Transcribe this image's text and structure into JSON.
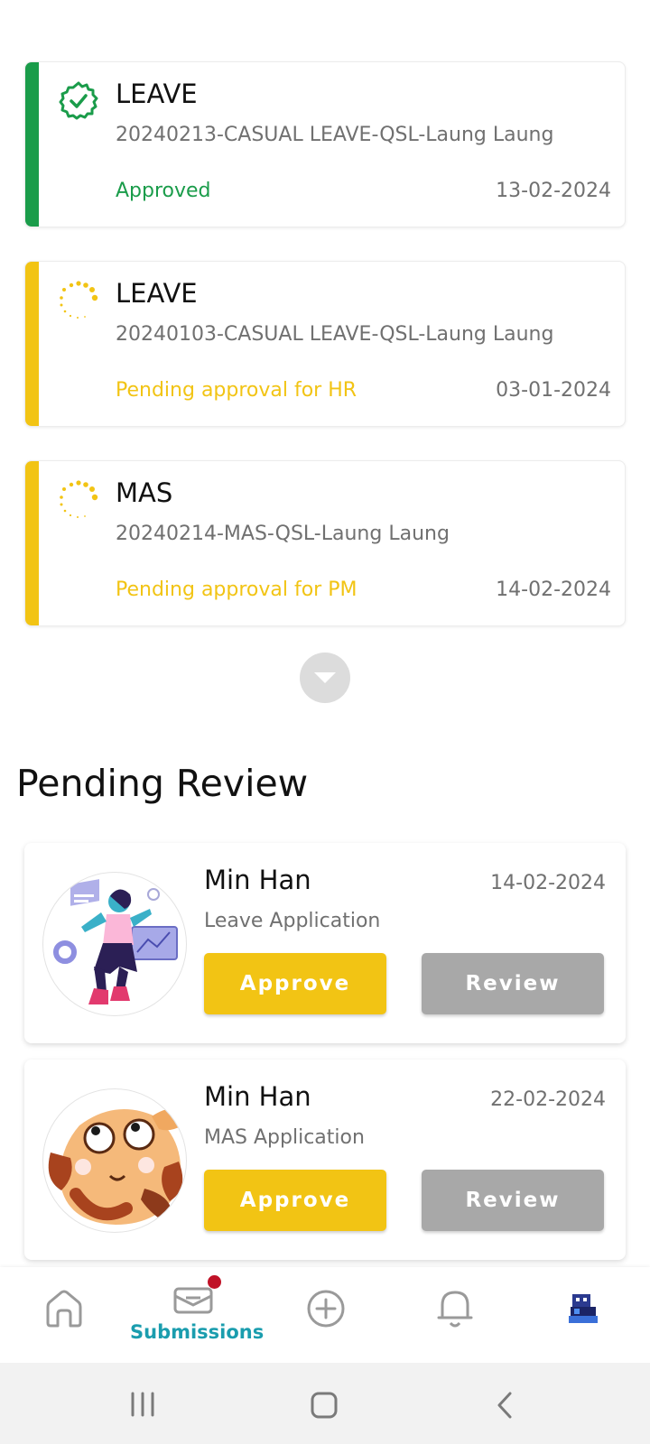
{
  "submissions": [
    {
      "type": "LEAVE",
      "ref": "20240213-CASUAL LEAVE-QSL-Laung Laung",
      "status": "Approved",
      "date": "13-02-2024",
      "state": "approved",
      "color": "#1a9c4a"
    },
    {
      "type": "LEAVE",
      "ref": "20240103-CASUAL LEAVE-QSL-Laung Laung",
      "status": "Pending approval for HR",
      "date": "03-01-2024",
      "state": "pending",
      "color": "#f2c414"
    },
    {
      "type": "MAS",
      "ref": "20240214-MAS-QSL-Laung Laung",
      "status": "Pending approval for PM",
      "date": "14-02-2024",
      "state": "pending",
      "color": "#f2c414"
    }
  ],
  "expand_icon": "chevron-down-icon",
  "pending_review": {
    "title": "Pending Review",
    "items": [
      {
        "name": "Min Han",
        "date": "14-02-2024",
        "type": "Leave Application",
        "approve_label": "Approve",
        "review_label": "Review",
        "avatar": "illustration-avatar"
      },
      {
        "name": "Min Han",
        "date": "22-02-2024",
        "type": "MAS Application",
        "approve_label": "Approve",
        "review_label": "Review",
        "avatar": "cartoon-avatar"
      }
    ]
  },
  "bottom_nav": {
    "items": [
      {
        "icon": "home-icon",
        "label": ""
      },
      {
        "icon": "mail-icon",
        "label": "Submissions",
        "active": true,
        "badge": true
      },
      {
        "icon": "add-circle-icon",
        "label": ""
      },
      {
        "icon": "bell-icon",
        "label": ""
      },
      {
        "icon": "profile-avatar-icon",
        "label": ""
      }
    ]
  },
  "system_nav": [
    "recents-icon",
    "home-button-icon",
    "back-icon"
  ],
  "colors": {
    "approved": "#1a9c4a",
    "pending": "#f2c414",
    "accent": "#1a9dae",
    "approve_button": "#f2c414",
    "review_button": "#a8a8a8"
  }
}
